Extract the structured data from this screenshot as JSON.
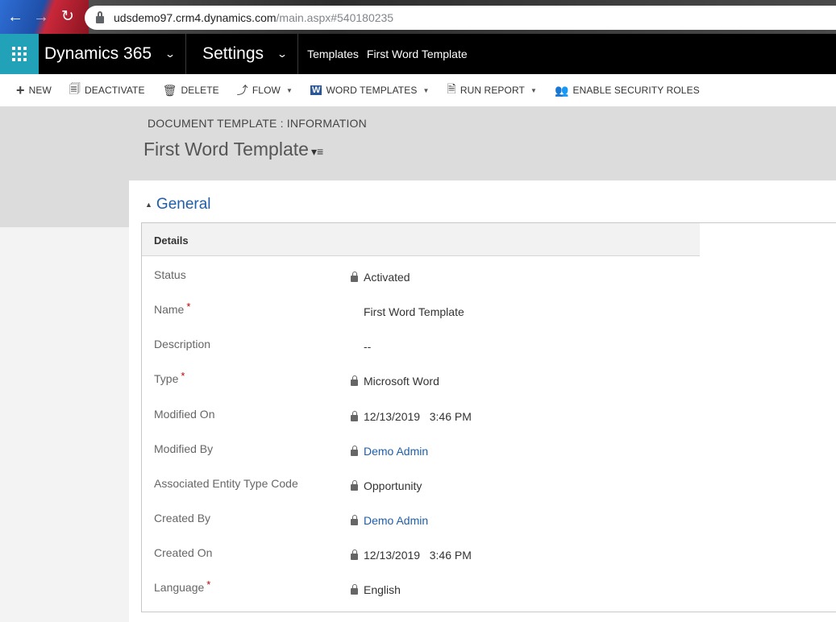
{
  "browser": {
    "url_host": "udsdemo97.crm4.dynamics.com",
    "url_path": "/main.aspx#540180235"
  },
  "appbar": {
    "app_name": "Dynamics 365",
    "area": "Settings",
    "breadcrumb_section": "Templates",
    "breadcrumb_record": "First Word Template"
  },
  "commands": [
    {
      "label": "NEW",
      "icon": "plus-icon",
      "dropdown": false
    },
    {
      "label": "DEACTIVATE",
      "icon": "deactivate-icon",
      "dropdown": false
    },
    {
      "label": "DELETE",
      "icon": "trash-icon",
      "dropdown": false
    },
    {
      "label": "FLOW",
      "icon": "flow-icon",
      "dropdown": true
    },
    {
      "label": "WORD TEMPLATES",
      "icon": "word-icon",
      "dropdown": true
    },
    {
      "label": "RUN REPORT",
      "icon": "report-icon",
      "dropdown": true
    },
    {
      "label": "ENABLE SECURITY ROLES",
      "icon": "security-roles-icon",
      "dropdown": false
    }
  ],
  "header": {
    "entity_label": "DOCUMENT TEMPLATE : INFORMATION",
    "record_title": "First Word Template"
  },
  "section": {
    "title": "General",
    "subsection_title": "Details"
  },
  "fields": [
    {
      "label": "Status",
      "required": false,
      "value": "Activated",
      "locked": true,
      "link": false
    },
    {
      "label": "Name",
      "required": true,
      "value": "First Word Template",
      "locked": false,
      "link": false
    },
    {
      "label": "Description",
      "required": false,
      "value": "--",
      "locked": false,
      "link": false
    },
    {
      "label": "Type",
      "required": true,
      "value": "Microsoft Word",
      "locked": true,
      "link": false
    },
    {
      "label": "Modified On",
      "required": false,
      "value": "12/13/2019   3:46 PM",
      "locked": true,
      "link": false
    },
    {
      "label": "Modified By",
      "required": false,
      "value": "Demo Admin",
      "locked": true,
      "link": true
    },
    {
      "label": "Associated Entity Type Code",
      "required": false,
      "value": "Opportunity",
      "locked": true,
      "link": false
    },
    {
      "label": "Created By",
      "required": false,
      "value": "Demo Admin",
      "locked": true,
      "link": true
    },
    {
      "label": "Created On",
      "required": false,
      "value": "12/13/2019   3:46 PM",
      "locked": true,
      "link": false
    },
    {
      "label": "Language",
      "required": true,
      "value": "English",
      "locked": true,
      "link": false
    }
  ],
  "colors": {
    "accent": "#21a2b8",
    "link": "#1f5ea8",
    "required": "#c00000"
  }
}
